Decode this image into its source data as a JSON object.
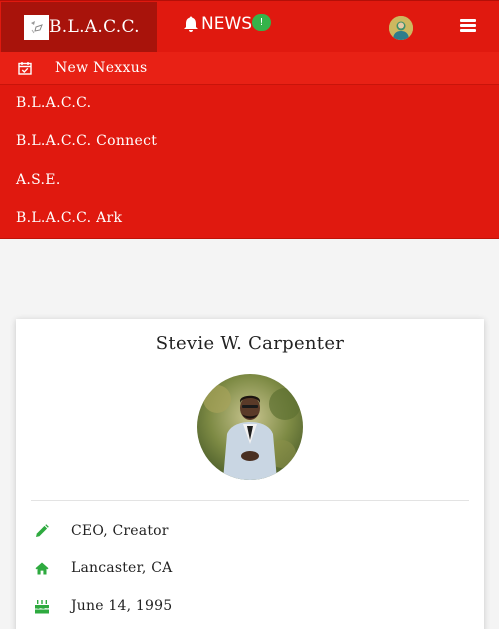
{
  "navbar": {
    "brand": "B.L.A.C.C.",
    "news_label": "NEWS",
    "news_badge": "!"
  },
  "menu": {
    "items": [
      {
        "label": "New Nexxus",
        "icon": "calendar-check-icon"
      },
      {
        "label": "B.L.A.C.C."
      },
      {
        "label": "B.L.A.C.C. Connect"
      },
      {
        "label": "A.S.E."
      },
      {
        "label": "B.L.A.C.C. Ark"
      }
    ]
  },
  "profile": {
    "name": "Stevie W. Carpenter",
    "details": [
      {
        "icon": "pencil-icon",
        "text": "CEO, Creator"
      },
      {
        "icon": "home-icon",
        "text": "Lancaster, CA"
      },
      {
        "icon": "birthday-cake-icon",
        "text": "June 14, 1995"
      }
    ]
  },
  "colors": {
    "primary_red": "#e0190f",
    "brand_dark_red": "#a8130b",
    "badge_green": "#35b34a",
    "icon_green": "#2eaa3f"
  }
}
